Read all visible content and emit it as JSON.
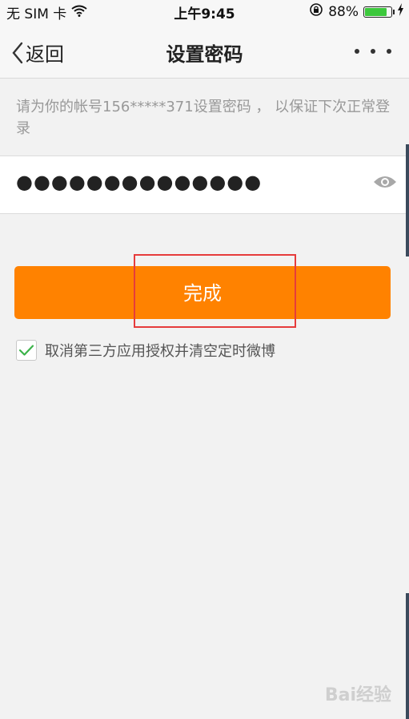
{
  "status_bar": {
    "carrier": "无 SIM 卡",
    "time": "上午9:45",
    "battery_percent": "88%",
    "battery_level": 0.88,
    "icons": [
      "wifi-icon",
      "orientation-lock-icon",
      "battery-icon",
      "charging-icon"
    ]
  },
  "nav": {
    "back_label": "返回",
    "title": "设置密码",
    "more_icon": "more-icon"
  },
  "hint_text": "请为你的帐号156*****371设置密码 ， 以保证下次正常登录",
  "password": {
    "masked_value": "●●●●●●●●●●●●●●",
    "toggle_icon": "eye-icon"
  },
  "done_button": {
    "label": "完成"
  },
  "checkbox": {
    "checked": true,
    "label": "取消第三方应用授权并清空定时微博"
  },
  "watermark": "Bai经验",
  "colors": {
    "accent": "#ff8200",
    "highlight": "#e63c3c",
    "check": "#3cb34a",
    "background": "#f2f2f2"
  }
}
